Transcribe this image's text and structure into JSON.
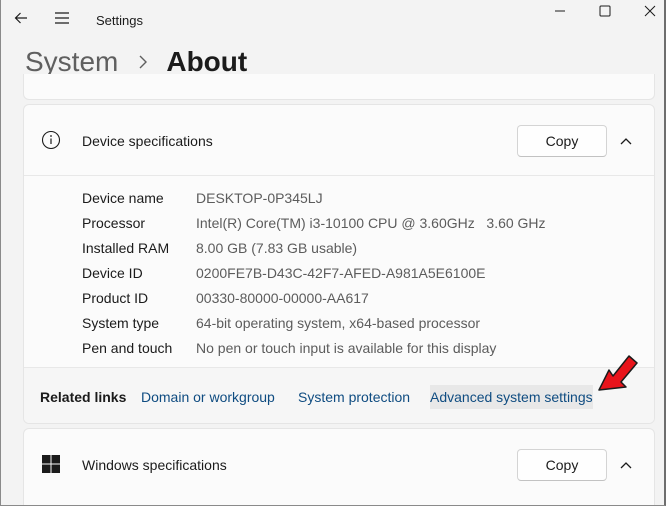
{
  "window": {
    "app_title": "Settings"
  },
  "breadcrumb": {
    "parent": "System",
    "current": "About"
  },
  "device_specs": {
    "title": "Device specifications",
    "copy_label": "Copy",
    "rows": [
      {
        "label": "Device name",
        "value": "DESKTOP-0P345LJ"
      },
      {
        "label": "Processor",
        "value": "Intel(R) Core(TM) i3-10100 CPU @ 3.60GHz   3.60 GHz"
      },
      {
        "label": "Installed RAM",
        "value": "8.00 GB (7.83 GB usable)"
      },
      {
        "label": "Device ID",
        "value": "0200FE7B-D43C-42F7-AFED-A981A5E6100E"
      },
      {
        "label": "Product ID",
        "value": "00330-80000-00000-AA617"
      },
      {
        "label": "System type",
        "value": "64-bit operating system, x64-based processor"
      },
      {
        "label": "Pen and touch",
        "value": "No pen or touch input is available for this display"
      }
    ]
  },
  "related_links": {
    "title": "Related links",
    "links": [
      "Domain or workgroup",
      "System protection",
      "Advanced system settings"
    ]
  },
  "windows_specs": {
    "title": "Windows specifications",
    "copy_label": "Copy"
  },
  "colors": {
    "accent_link": "#0f4c81",
    "arrow": "#e8141b"
  }
}
